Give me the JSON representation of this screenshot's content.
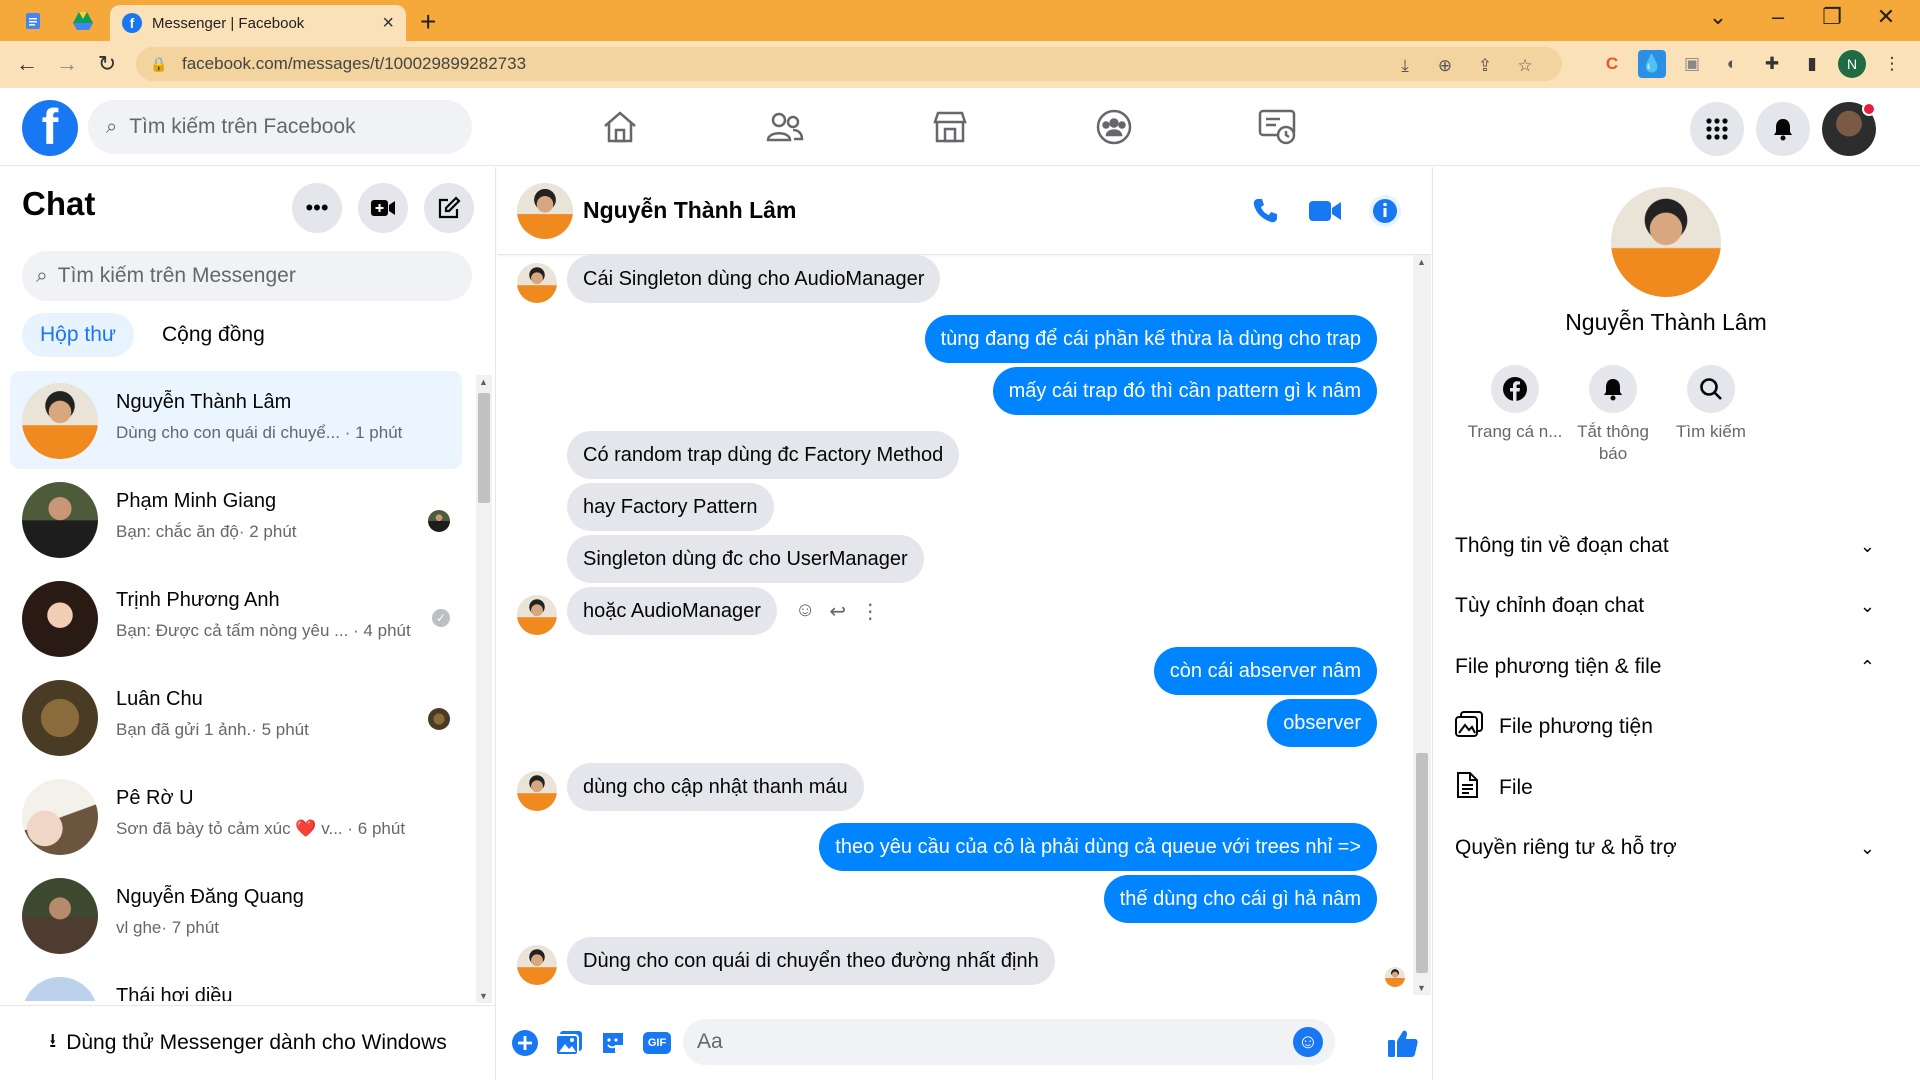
{
  "browser": {
    "tab_title": "Messenger | Facebook",
    "url": "facebook.com/messages/t/100029899282733",
    "profile_initial": "N"
  },
  "fb_header": {
    "search_placeholder": "Tìm kiếm trên Facebook"
  },
  "sidebar": {
    "title": "Chat",
    "search_placeholder": "Tìm kiếm trên Messenger",
    "tabs": [
      {
        "label": "Hộp thư",
        "active": true
      },
      {
        "label": "Cộng đồng",
        "active": false
      }
    ],
    "conversations": [
      {
        "name": "Nguyễn Thành Lâm",
        "preview": "Dùng cho con quái di chuyể...",
        "time": "· 1 phút",
        "active": true
      },
      {
        "name": "Phạm Minh Giang",
        "preview": "Bạn: chắc ăn độ",
        "time": "· 2 phút"
      },
      {
        "name": "Trịnh Phương Anh",
        "preview": "Bạn: Được cả tấm nòng yêu ...",
        "time": "· 4 phút"
      },
      {
        "name": "Luân Chu",
        "preview": "Bạn đã gửi 1 ảnh.",
        "time": "· 5 phút"
      },
      {
        "name": "Pê Rờ U",
        "preview": "Sơn đã bày tỏ cảm xúc ❤️ v...",
        "time": "· 6 phút"
      },
      {
        "name": "Nguyễn Đăng Quang",
        "preview": "vl ghe",
        "time": "· 7 phút"
      },
      {
        "name": "Thái hơi diều",
        "preview": "",
        "time": ""
      }
    ],
    "try_windows": "Dùng thử Messenger dành cho Windows"
  },
  "chat": {
    "contact_name": "Nguyễn Thành Lâm",
    "messages": [
      {
        "dir": "in",
        "text": "Cái Singleton dùng cho AudioManager"
      },
      {
        "dir": "out",
        "text": "tùng đang để cái phần kế thừa là dùng cho trap"
      },
      {
        "dir": "out",
        "text": "mấy cái trap đó thì cần pattern gì k nâm"
      },
      {
        "dir": "in",
        "text": "Có random trap dùng đc Factory Method"
      },
      {
        "dir": "in",
        "text": "hay Factory Pattern"
      },
      {
        "dir": "in",
        "text": "Singleton dùng đc cho UserManager"
      },
      {
        "dir": "in",
        "text": "hoặc AudioManager"
      },
      {
        "dir": "out",
        "text": "còn cái abserver nâm"
      },
      {
        "dir": "out",
        "text": "observer"
      },
      {
        "dir": "in",
        "text": "dùng cho cập nhật thanh máu"
      },
      {
        "dir": "out",
        "text": "theo yêu cầu của cô là phải dùng cả queue với trees nhỉ =>"
      },
      {
        "dir": "out",
        "text": "thế dùng cho cái gì hả nâm"
      },
      {
        "dir": "in",
        "text": "Dùng cho con quái di chuyển theo đường nhất định"
      }
    ],
    "composer_placeholder": "Aa",
    "gif_label": "GIF"
  },
  "info_panel": {
    "name": "Nguyễn Thành Lâm",
    "actions": [
      {
        "label": "Trang cá n...",
        "icon": "facebook-icon"
      },
      {
        "label": "Tắt thông báo",
        "icon": "bell-icon"
      },
      {
        "label": "Tìm kiếm",
        "icon": "search-icon"
      }
    ],
    "sections": [
      {
        "label": "Thông tin về đoạn chat",
        "expanded": false
      },
      {
        "label": "Tùy chỉnh đoạn chat",
        "expanded": false
      },
      {
        "label": "File phương tiện & file",
        "expanded": true
      },
      {
        "label": "Quyền riêng tư & hỗ trợ",
        "expanded": false
      }
    ],
    "sub_items": [
      {
        "label": "File phương tiện",
        "icon": "media-icon"
      },
      {
        "label": "File",
        "icon": "file-icon"
      }
    ]
  },
  "colors": {
    "brand_blue": "#1877f2",
    "outgoing_bubble": "#0084ff",
    "incoming_bubble": "#e4e6eb",
    "browser_frame": "#f6a93b"
  }
}
